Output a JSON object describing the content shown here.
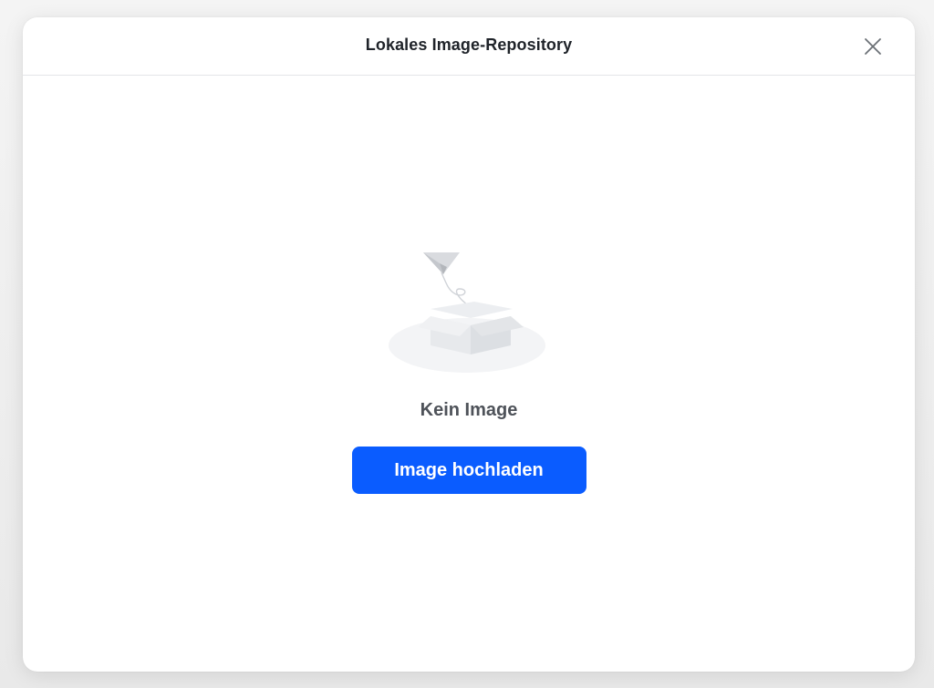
{
  "dialog": {
    "title": "Lokales Image-Repository",
    "close_icon": "close-icon"
  },
  "empty_state": {
    "illustration_icon": "empty-box-paper-plane-icon",
    "message": "Kein Image",
    "upload_button_label": "Image hochladen"
  },
  "colors": {
    "accent": "#0a5cff",
    "title_text": "#1f2329",
    "muted_text": "#4e5259",
    "divider": "#e3e5e8"
  }
}
